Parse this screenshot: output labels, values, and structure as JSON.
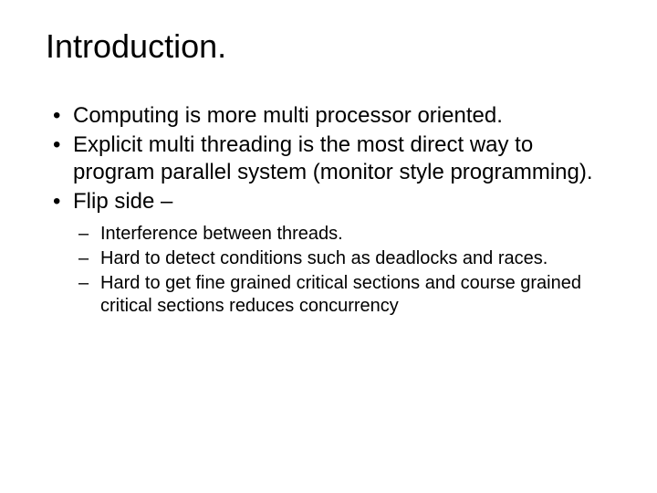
{
  "title": "Introduction.",
  "bullets": [
    {
      "text": "Computing is more multi processor oriented."
    },
    {
      "text": "Explicit multi threading is the most direct way to program parallel system (monitor style programming)."
    },
    {
      "text": "Flip side –",
      "sub": [
        {
          "text": "Interference between threads."
        },
        {
          "text": "Hard to detect conditions such as deadlocks and races."
        },
        {
          "text": "Hard to get fine grained critical sections and course grained critical sections reduces concurrency"
        }
      ]
    }
  ]
}
